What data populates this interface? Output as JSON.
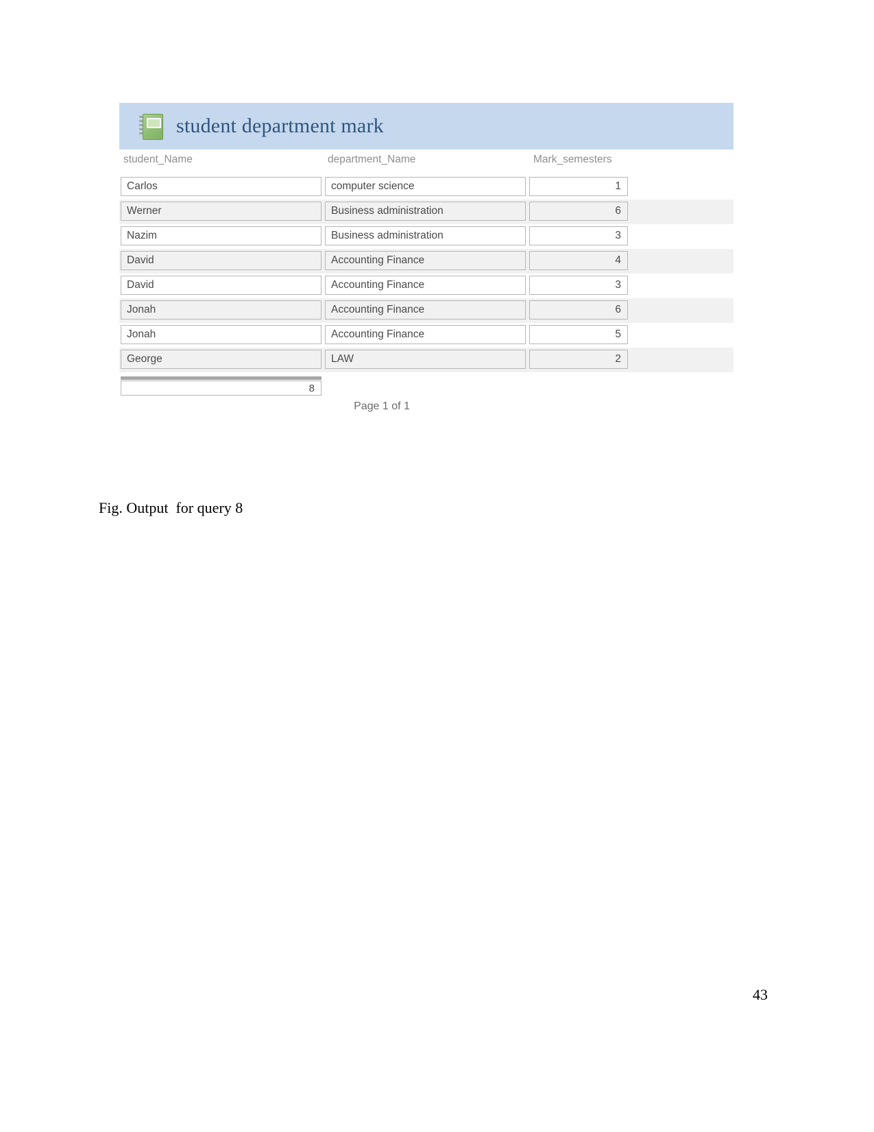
{
  "document": {
    "caption": "Fig. Output  for query 8",
    "page_number": "43"
  },
  "report": {
    "title": "student department mark",
    "icon": "report-notebook-icon",
    "header_background": "#c5d8ee",
    "title_color": "#31547e",
    "page_indicator": "Page 1 of 1",
    "summary_count": "8",
    "columns": [
      "student_Name",
      "department_Name",
      "Mark_semesters"
    ],
    "rows": [
      {
        "student_Name": "Carlos",
        "department_Name": "computer science",
        "Mark_semesters": "1"
      },
      {
        "student_Name": "Werner",
        "department_Name": "Business administration",
        "Mark_semesters": "6"
      },
      {
        "student_Name": "Nazim",
        "department_Name": "Business administration",
        "Mark_semesters": "3"
      },
      {
        "student_Name": "David",
        "department_Name": "Accounting Finance",
        "Mark_semesters": "4"
      },
      {
        "student_Name": "David",
        "department_Name": "Accounting Finance",
        "Mark_semesters": "3"
      },
      {
        "student_Name": "Jonah",
        "department_Name": "Accounting Finance",
        "Mark_semesters": "6"
      },
      {
        "student_Name": "Jonah",
        "department_Name": "Accounting Finance",
        "Mark_semesters": "5"
      },
      {
        "student_Name": "George",
        "department_Name": "LAW",
        "Mark_semesters": "2"
      }
    ]
  }
}
